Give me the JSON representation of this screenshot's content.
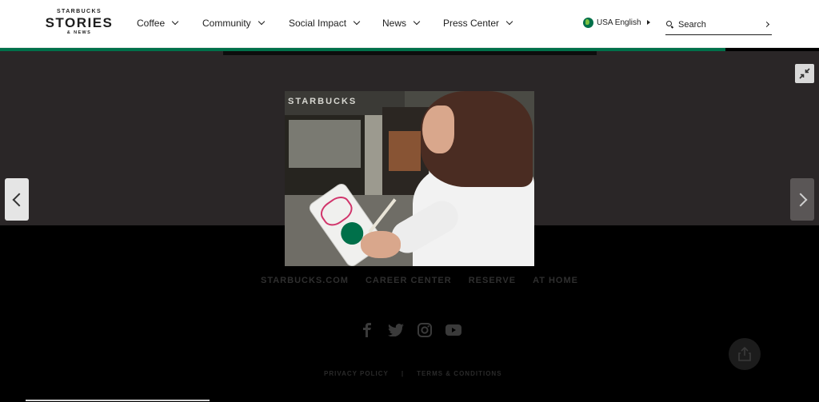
{
  "header": {
    "logo": {
      "top": "STARBUCKS",
      "main": "STORIES",
      "sub": "& NEWS"
    },
    "nav": [
      {
        "label": "Coffee"
      },
      {
        "label": "Community"
      },
      {
        "label": "Social Impact"
      },
      {
        "label": "News"
      },
      {
        "label": "Press Center"
      }
    ],
    "language": "USA English",
    "search_placeholder": "Search"
  },
  "footer": {
    "links": [
      "STARBUCKS.COM",
      "CAREER CENTER",
      "RESERVE",
      "AT HOME"
    ],
    "social_icons": [
      "facebook-icon",
      "twitter-icon",
      "instagram-icon",
      "youtube-icon"
    ],
    "legal": [
      "PRIVACY POLICY",
      "TERMS & CONDITIONS"
    ],
    "legal_separator": "|"
  },
  "lightbox": {
    "photo_sign_text": "STARBUCKS",
    "controls": [
      "previous-arrow",
      "next-arrow",
      "collapse-icon"
    ]
  },
  "colors": {
    "brand_green": "#00704a",
    "overlay_top": "#2a2627",
    "overlay_bottom": "#000000"
  }
}
